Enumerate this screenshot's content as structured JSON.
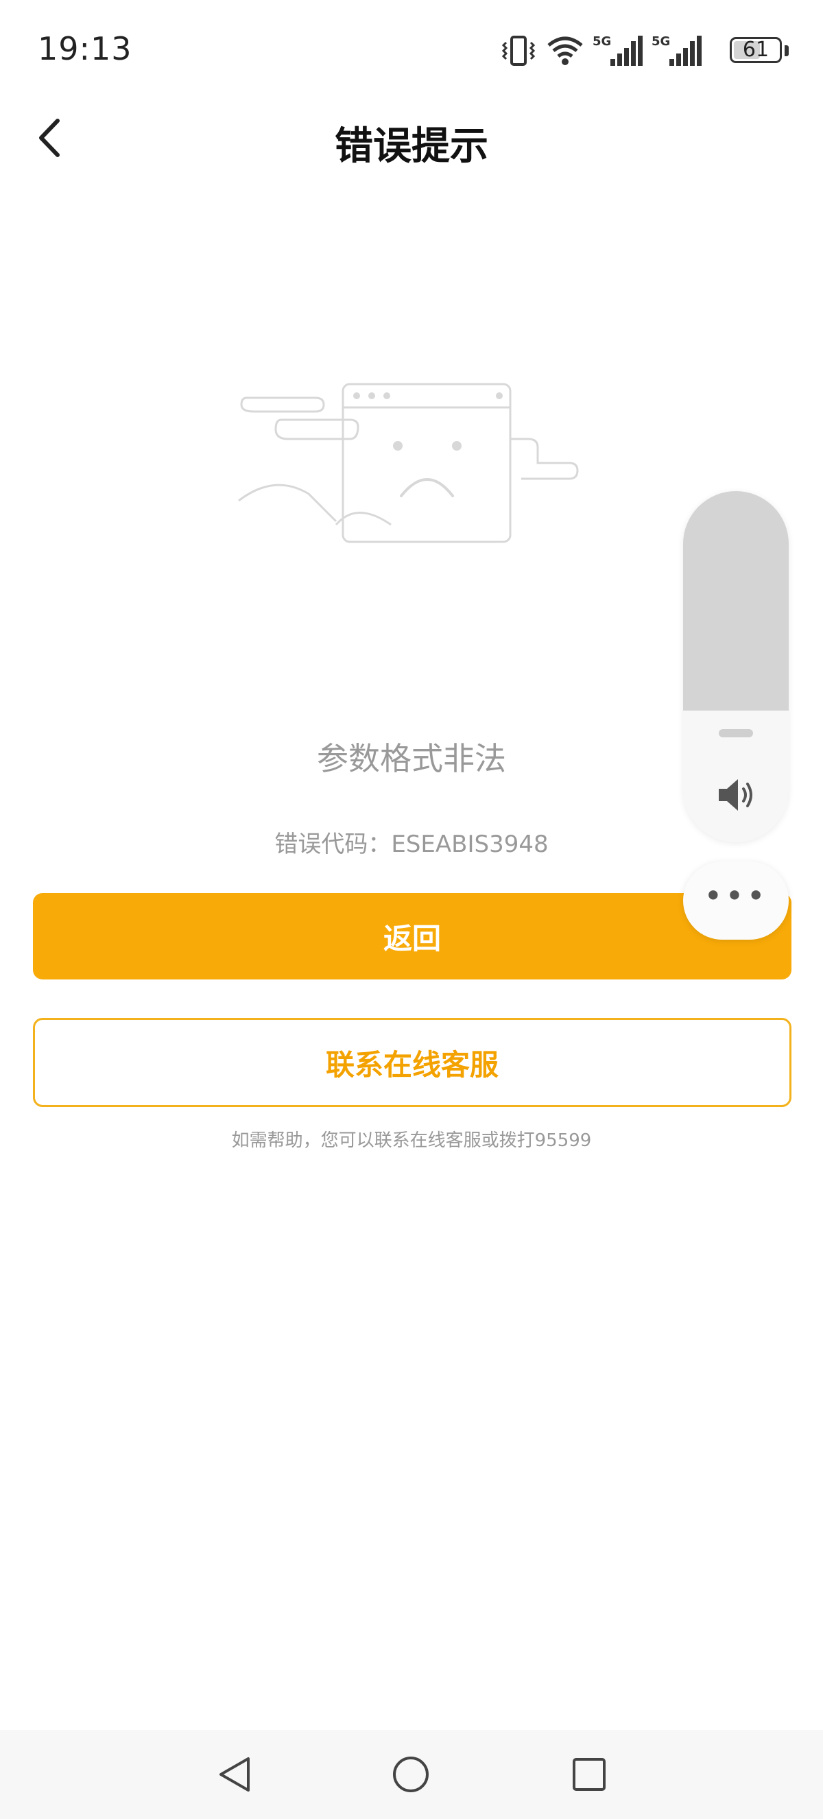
{
  "status_bar": {
    "time": "19:13",
    "net1": "5G",
    "net2": "5G",
    "battery_level": "61",
    "icons": [
      "vibrate-icon",
      "wifi-icon",
      "signal-5g-icon",
      "signal-5g-icon",
      "battery-icon"
    ]
  },
  "header": {
    "title": "错误提示",
    "back_icon": "chevron-left-icon"
  },
  "error": {
    "message": "参数格式非法",
    "code_label": "错误代码：ESEABIS3948",
    "illustration": "sad-browser-illustration"
  },
  "actions": {
    "return_label": "返回",
    "contact_label": "联系在线客服"
  },
  "help": {
    "text": "如需帮助，您可以联系在线客服或拨打95599"
  },
  "overlay": {
    "volume_icon": "speaker-icon",
    "more_icon": "more-dots-icon",
    "more_label": "•••",
    "volume_level": 0
  },
  "nav_bar": {
    "icons": [
      "nav-back-icon",
      "nav-home-icon",
      "nav-recent-icon"
    ]
  },
  "colors": {
    "accent": "#f8aa08",
    "accent_border": "#f3b21c",
    "muted_text": "#999999"
  }
}
